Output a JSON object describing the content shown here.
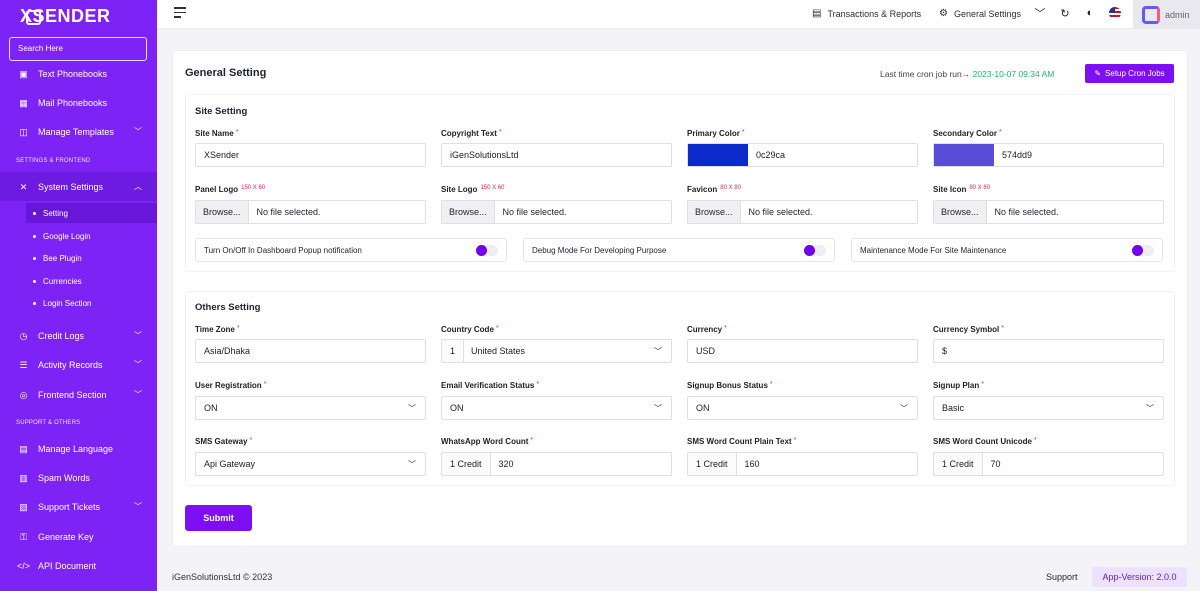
{
  "brand": {
    "name": "XSENDER"
  },
  "search": {
    "placeholder": "Search Here"
  },
  "sidebar": {
    "items": [
      {
        "label": "Text Phonebooks"
      },
      {
        "label": "Mail Phonebooks"
      },
      {
        "label": "Manage Templates"
      },
      {
        "label": "System Settings"
      },
      {
        "label": "Credit Logs"
      },
      {
        "label": "Activity Records"
      },
      {
        "label": "Frontend Section"
      },
      {
        "label": "Manage Language"
      },
      {
        "label": "Spam Words"
      },
      {
        "label": "Support Tickets"
      },
      {
        "label": "Generate Key"
      },
      {
        "label": "API Document"
      }
    ],
    "sections": {
      "settings": "SETTINGS & FRONTEND",
      "support": "SUPPORT & OTHERS"
    },
    "sub": [
      "Setting",
      "Google Login",
      "Bee Plugin",
      "Currencies",
      "Login Section"
    ]
  },
  "topbar": {
    "transactions": "Transactions & Reports",
    "general": "General Settings",
    "user": "admin"
  },
  "page": {
    "title": "General Setting",
    "cron_label": "Last time cron job run→",
    "cron_time": "2023-10-07 09:34 AM",
    "cron_button": "Setup Cron Jobs"
  },
  "site": {
    "title": "Site Setting",
    "site_name": {
      "label": "Site Name",
      "value": "XSender"
    },
    "copyright": {
      "label": "Copyright Text",
      "value": "iGenSolutionsLtd"
    },
    "primary": {
      "label": "Primary Color",
      "value": "0c29ca",
      "color": "#0c29ca"
    },
    "secondary": {
      "label": "Secondary Color",
      "value": "574dd9",
      "color": "#574dd9"
    },
    "panel_logo": {
      "label": "Panel Logo",
      "hint": "150 X 60"
    },
    "site_logo": {
      "label": "Site Logo",
      "hint": "150 X 60"
    },
    "favicon": {
      "label": "Favicon",
      "hint": "80 X 80"
    },
    "site_icon": {
      "label": "Site Icon",
      "hint": "80 X 80"
    },
    "file_button": "Browse...",
    "file_text": "No file selected.",
    "toggles": [
      "Turn On/Off In Dashboard Popup notification",
      "Debug Mode For Developing Purpose",
      "Maintenance Mode For Site Maintenance"
    ]
  },
  "others": {
    "title": "Others Setting",
    "timezone": {
      "label": "Time Zone",
      "value": "Asia/Dhaka"
    },
    "country": {
      "label": "Country Code",
      "code": "1",
      "value": "United States"
    },
    "currency": {
      "label": "Currency",
      "value": "USD"
    },
    "symbol": {
      "label": "Currency Symbol",
      "value": "$"
    },
    "registration": {
      "label": "User Registration",
      "value": "ON"
    },
    "email_verify": {
      "label": "Email Verification Status",
      "value": "ON"
    },
    "bonus": {
      "label": "Signup Bonus Status",
      "value": "ON"
    },
    "plan": {
      "label": "Signup Plan",
      "value": "Basic"
    },
    "gateway": {
      "label": "SMS Gateway",
      "value": "Api Gateway"
    },
    "whatsapp": {
      "label": "WhatsApp Word Count",
      "prefix": "1 Credit",
      "value": "320"
    },
    "plain": {
      "label": "SMS Word Count Plain Text",
      "prefix": "1 Credit",
      "value": "160"
    },
    "unicode": {
      "label": "SMS Word Count Unicode",
      "prefix": "1 Credit",
      "value": "70"
    }
  },
  "submit": "Submit",
  "footer": {
    "copyright": "iGenSolutionsLtd © 2023",
    "support": "Support",
    "version": "App-Version: 2.0.0"
  }
}
